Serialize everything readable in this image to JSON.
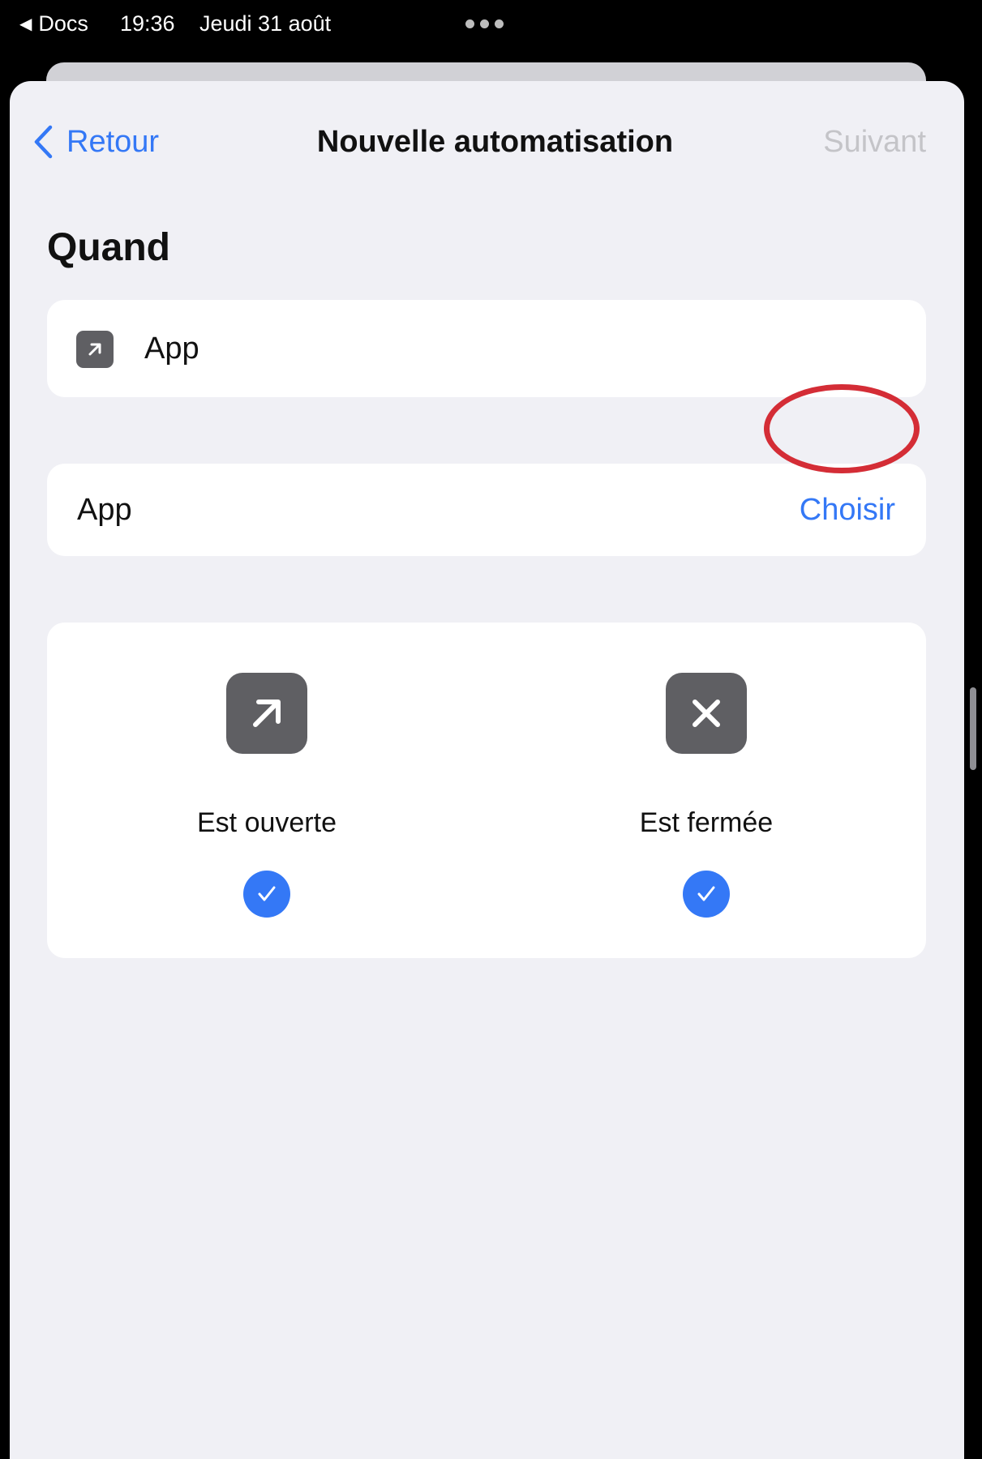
{
  "status_bar": {
    "back_app": "Docs",
    "time": "19:36",
    "date": "Jeudi 31 août"
  },
  "nav": {
    "back_label": "Retour",
    "title": "Nouvelle automatisation",
    "next_label": "Suivant"
  },
  "section": {
    "title": "Quand"
  },
  "trigger": {
    "label": "App",
    "icon": "arrow-up-right-icon"
  },
  "app_row": {
    "label": "App",
    "action": "Choisir"
  },
  "options": [
    {
      "label": "Est ouverte",
      "icon": "arrow-up-right-icon",
      "checked": true
    },
    {
      "label": "Est fermée",
      "icon": "close-icon",
      "checked": true
    }
  ],
  "colors": {
    "accent": "#3478f6",
    "highlight": "#d42d36",
    "icon_bg": "#5f5f63",
    "disabled": "#c4c4c8"
  }
}
